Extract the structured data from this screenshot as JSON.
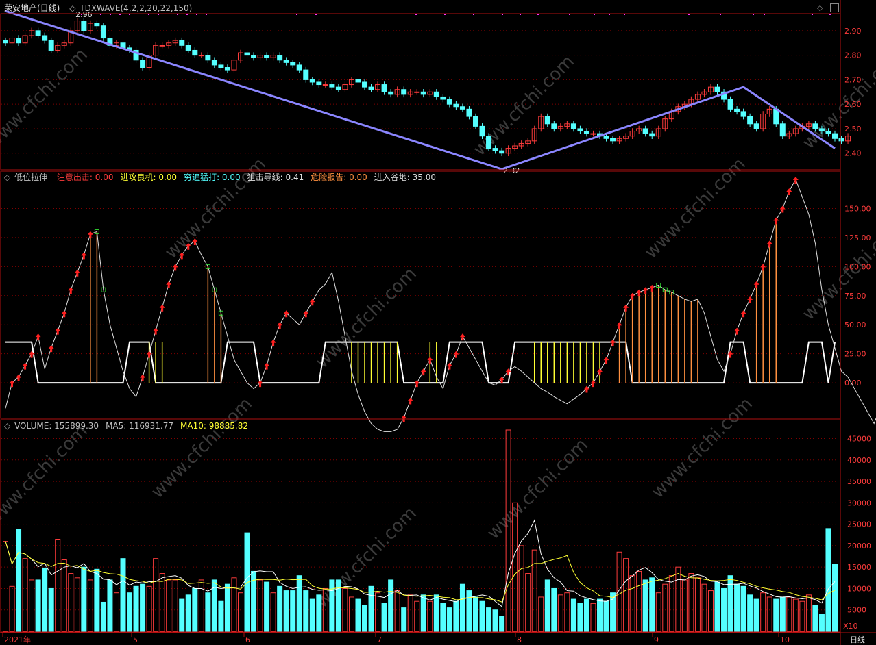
{
  "colors": {
    "up": "#ff3c3c",
    "down": "#54ffff",
    "grid": "#800000",
    "frame": "#b01010",
    "wave": "#8b86ff",
    "white": "#ffffff",
    "yellow": "#ffff33",
    "orange": "#ff9040",
    "green": "#33dd33",
    "magenta": "#ff33ff",
    "watermark": "#3a3a3a"
  },
  "panel1": {
    "stock": "荣安地产(日线)",
    "indicator": "TDXWAVE(4,2,2,20,22,150)",
    "high_label": "2.96",
    "low_label": "2.32",
    "yticks": [
      "2.90",
      "2.80",
      "2.70",
      "2.60",
      "2.50",
      "2.40"
    ]
  },
  "panel2": {
    "name": "低位拉伸",
    "items": [
      {
        "label": "注意出击:",
        "value": "0.00",
        "color": "#ff3c3c"
      },
      {
        "label": "进攻良机:",
        "value": "0.00",
        "color": "#ffff33"
      },
      {
        "label": "穷追猛打:",
        "value": "0.00",
        "color": "#54ffff"
      },
      {
        "label": "狙击导线:",
        "value": "0.41",
        "color": "#e0e0e0"
      },
      {
        "label": "危险报告:",
        "value": "0.00",
        "color": "#ff9040"
      },
      {
        "label": "进入谷地:",
        "value": "35.00",
        "color": "#e0e0e0"
      }
    ],
    "yticks": [
      "150.00",
      "125.00",
      "100.00",
      "75.00",
      "50.00",
      "25.00",
      "0.00"
    ]
  },
  "panel3": {
    "items": [
      {
        "label": "VOLUME:",
        "value": "155899.30",
        "color": "#c0c0c0"
      },
      {
        "label": "MA5:",
        "value": "116931.77",
        "color": "#c0c0c0"
      },
      {
        "label": "MA10:",
        "value": "98885.82",
        "color": "#ffff33"
      }
    ],
    "yticks": [
      "45000",
      "40000",
      "35000",
      "30000",
      "25000",
      "20000",
      "15000",
      "10000",
      "5000"
    ],
    "unit": "X10"
  },
  "xaxis": {
    "labels": [
      "2021年",
      "5",
      "6",
      "7",
      "8",
      "9",
      "10"
    ],
    "period": "日线"
  },
  "watermark": "www.cfchi.com",
  "chart_data": [
    {
      "type": "candlestick",
      "title": "荣安地产(日线)",
      "ylim": [
        2.32,
        2.98
      ],
      "series": [
        {
          "name": "close",
          "values": [
            2.85,
            2.87,
            2.85,
            2.88,
            2.9,
            2.88,
            2.86,
            2.82,
            2.84,
            2.85,
            2.9,
            2.94,
            2.9,
            2.93,
            2.92,
            2.87,
            2.84,
            2.85,
            2.83,
            2.82,
            2.78,
            2.75,
            2.8,
            2.84,
            2.84,
            2.85,
            2.86,
            2.84,
            2.82,
            2.8,
            2.8,
            2.78,
            2.76,
            2.75,
            2.74,
            2.78,
            2.81,
            2.8,
            2.79,
            2.8,
            2.79,
            2.8,
            2.78,
            2.77,
            2.76,
            2.74,
            2.7,
            2.69,
            2.68,
            2.68,
            2.67,
            2.66,
            2.68,
            2.7,
            2.69,
            2.67,
            2.66,
            2.68,
            2.65,
            2.64,
            2.66,
            2.64,
            2.65,
            2.65,
            2.64,
            2.65,
            2.63,
            2.62,
            2.6,
            2.59,
            2.58,
            2.55,
            2.51,
            2.47,
            2.42,
            2.41,
            2.4,
            2.42,
            2.43,
            2.44,
            2.45,
            2.5,
            2.55,
            2.52,
            2.5,
            2.51,
            2.52,
            2.5,
            2.49,
            2.48,
            2.48,
            2.47,
            2.46,
            2.45,
            2.46,
            2.47,
            2.49,
            2.5,
            2.48,
            2.47,
            2.5,
            2.54,
            2.57,
            2.59,
            2.6,
            2.62,
            2.64,
            2.65,
            2.67,
            2.65,
            2.62,
            2.58,
            2.57,
            2.55,
            2.52,
            2.5,
            2.56,
            2.58,
            2.52,
            2.47,
            2.48,
            2.5,
            2.51,
            2.52,
            2.5,
            2.49,
            2.48,
            2.46,
            2.45,
            2.47
          ]
        }
      ]
    },
    {
      "type": "line",
      "title": "低位拉伸",
      "ylim": [
        -30,
        175
      ],
      "series": [
        {
          "name": "狙击导线",
          "values": [
            -22,
            0,
            5,
            15,
            25,
            40,
            12,
            30,
            45,
            60,
            80,
            95,
            110,
            128,
            130,
            80,
            50,
            30,
            10,
            -5,
            -12,
            5,
            25,
            45,
            65,
            85,
            100,
            110,
            118,
            122,
            110,
            100,
            80,
            60,
            40,
            20,
            10,
            0,
            -5,
            0,
            15,
            35,
            50,
            60,
            55,
            50,
            60,
            70,
            80,
            85,
            95,
            70,
            40,
            10,
            -10,
            -25,
            -35,
            -40,
            -42,
            -42,
            -40,
            -30,
            -15,
            0,
            10,
            20,
            5,
            -5,
            15,
            25,
            40,
            30,
            20,
            10,
            0,
            -2,
            3,
            10,
            14,
            10,
            5,
            0,
            -5,
            -8,
            -12,
            -15,
            -18,
            -14,
            -10,
            -5,
            0,
            10,
            20,
            35,
            50,
            65,
            75,
            78,
            80,
            82,
            84,
            80,
            78,
            75,
            72,
            70,
            72,
            60,
            40,
            20,
            10,
            25,
            45,
            60,
            72,
            85,
            100,
            120,
            140,
            150,
            165,
            175,
            160,
            145,
            120,
            80,
            50,
            30,
            10,
            5,
            -5,
            -15,
            -25,
            -35,
            -20,
            -5,
            10,
            8,
            5,
            0,
            5,
            0
          ]
        }
      ]
    },
    {
      "type": "bar",
      "title": "VOLUME",
      "ylim": [
        0,
        47000
      ],
      "series": [
        {
          "name": "VOLUME",
          "values": [
            21000,
            10500,
            23800,
            17000,
            12000,
            12000,
            14800,
            10000,
            21500,
            16700,
            13500,
            12500,
            15000,
            12000,
            14500,
            6800,
            12000,
            9000,
            17000,
            9000,
            10500,
            11000,
            10500,
            17000,
            13500,
            12000,
            12000,
            7500,
            8500,
            10000,
            12000,
            9000,
            12000,
            7000,
            11000,
            12500,
            9000,
            23000,
            14000,
            12000,
            11500,
            9000,
            10500,
            9500,
            9500,
            13000,
            9500,
            7500,
            8500,
            10000,
            12000,
            12000,
            10000,
            8000,
            7500,
            6000,
            10500,
            9000,
            6500,
            12000,
            9500,
            5500,
            8500,
            7000,
            8500,
            7000,
            8500,
            6500,
            5500,
            7000,
            11000,
            9500,
            8000,
            7000,
            5500,
            5000,
            3500,
            47000,
            30000,
            20000,
            13500,
            19000,
            8000,
            12000,
            10000,
            8500,
            9000,
            7500,
            6500,
            7500,
            6500,
            7500,
            7000,
            9000,
            18500,
            17000,
            13000,
            14000,
            12000,
            12500,
            9000,
            11000,
            13000,
            15000,
            12000,
            13500,
            12500,
            11000,
            9500,
            11500,
            10000,
            13000,
            11000,
            10500,
            8500,
            7500,
            9000,
            8000,
            7500,
            8000,
            8000,
            7500,
            7000,
            8500,
            6000,
            4000,
            24000,
            15600
          ]
        },
        {
          "name": "MA5",
          "values": []
        },
        {
          "name": "MA10",
          "values": []
        }
      ]
    }
  ]
}
